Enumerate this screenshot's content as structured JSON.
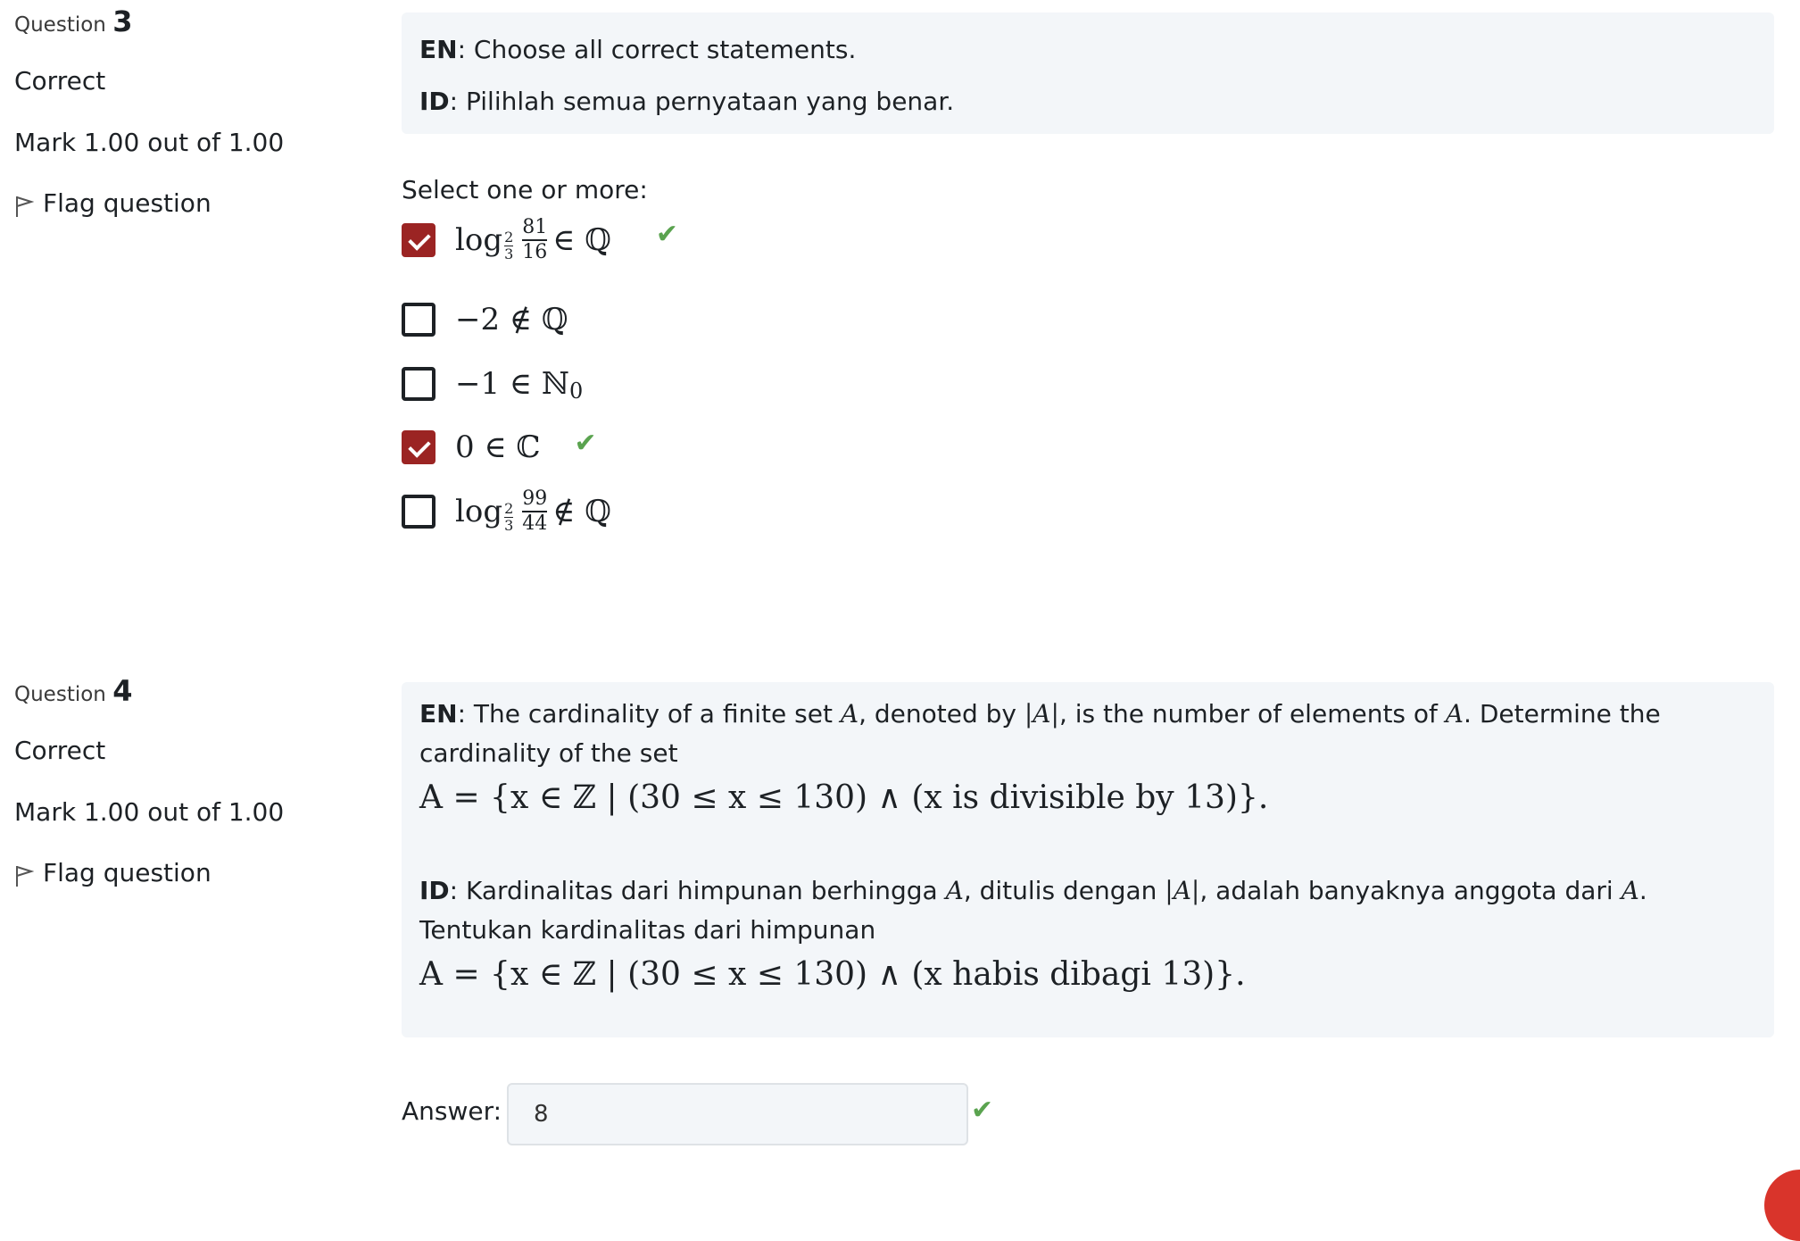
{
  "q3": {
    "label": "Question",
    "number": "3",
    "state": "Correct",
    "grade": "Mark 1.00 out of 1.00",
    "flag": "Flag question",
    "en_prefix": "EN",
    "en_text": ": Choose all correct statements.",
    "id_prefix": "ID",
    "id_text": ": Pilihlah semua pernyataan yang benar.",
    "prompt": "Select one or more:",
    "choices": [
      {
        "checked": true,
        "correct_mark": true
      },
      {
        "checked": false,
        "correct_mark": false
      },
      {
        "checked": false,
        "correct_mark": false
      },
      {
        "checked": true,
        "correct_mark": true
      },
      {
        "checked": false,
        "correct_mark": false
      }
    ],
    "c1": {
      "log": "log",
      "base_num": "2",
      "base_den": "3",
      "num": "81",
      "den": "16",
      "rel": "∈",
      "set": "ℚ"
    },
    "c2": {
      "expr": "−2 ∉ ℚ"
    },
    "c3": {
      "expr": "−1 ∈ ℕ",
      "sub": "0"
    },
    "c4": {
      "expr": "0 ∈ ℂ"
    },
    "c5": {
      "log": "log",
      "base_num": "2",
      "base_den": "3",
      "num": "99",
      "den": "44",
      "rel": "∉",
      "set": "ℚ"
    },
    "tick": "✔"
  },
  "q4": {
    "label": "Question",
    "number": "4",
    "state": "Correct",
    "grade": "Mark 1.00 out of 1.00",
    "flag": "Flag question",
    "en_prefix": "EN",
    "en_t1": ": The cardinality of a finite set ",
    "en_A1": "A",
    "en_t2": ", denoted by ",
    "en_absA": "|A|",
    "en_t3": ", is the number of elements of ",
    "en_A2": "A",
    "en_t4": ". Determine the cardinality of the set",
    "en_formula": "A = {x ∈ ℤ | (30 ≤ x ≤ 130) ∧ (x is divisible by 13)}.",
    "id_prefix": "ID",
    "id_t1": ": Kardinalitas dari himpunan berhingga ",
    "id_A1": "A",
    "id_t2": ", ditulis dengan ",
    "id_absA": "|A|",
    "id_t3": ", adalah banyaknya anggota dari ",
    "id_A2": "A",
    "id_t4": ". Tentukan kardinalitas dari himpunan",
    "id_formula": "A = {x ∈ ℤ | (30 ≤ x ≤ 130) ∧ (x habis dibagi 13)}.",
    "answer_label": "Answer:",
    "answer_value": "8",
    "tick": "✔"
  },
  "colors": {
    "checkbox_checked": "#9b2423",
    "correct_tick": "#5aa34f",
    "panel_bg": "#f3f6f9"
  }
}
